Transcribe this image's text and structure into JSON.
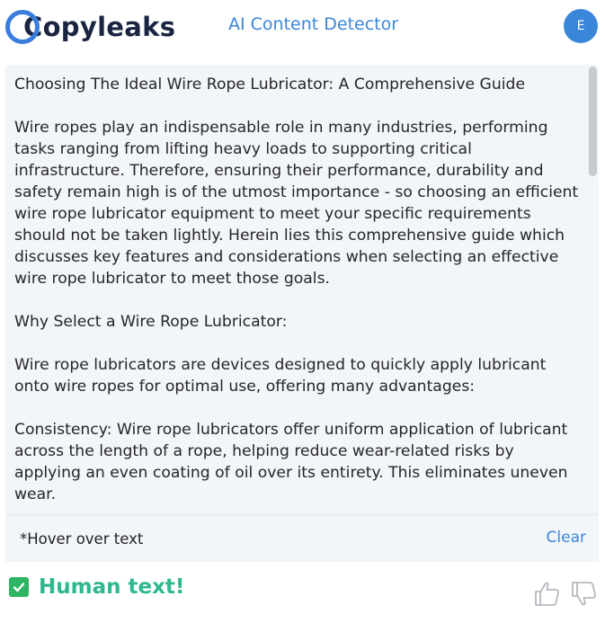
{
  "header": {
    "logo_text": "Copyleaks",
    "title": "AI Content Detector",
    "avatar_initial": "E"
  },
  "content": {
    "text": "Choosing The Ideal Wire Rope Lubricator: A Comprehensive Guide\n\nWire ropes play an indispensable role in many industries, performing tasks ranging from lifting heavy loads to supporting critical infrastructure. Therefore, ensuring their performance, durability and safety remain high is of the utmost importance - so choosing an efficient wire rope lubricator equipment to meet your specific requirements should not be taken lightly. Herein lies this comprehensive guide which discusses key features and considerations when selecting an effective wire rope lubricator to meet those goals.\n\nWhy Select a Wire Rope Lubricator:\n\nWire rope lubricators are devices designed to quickly apply lubricant onto wire ropes for optimal use, offering many advantages:\n\nConsistency: Wire rope lubricators offer uniform application of lubricant across the length of a rope, helping reduce wear-related risks by applying an even coating of oil over its entirety. This eliminates uneven wear.\n\nTime Efficiency: Lubricating wire ropes manually can be time-consuming and"
  },
  "footer": {
    "hover_hint": "*Hover over text",
    "clear_label": "Clear"
  },
  "result": {
    "label": "Human text!",
    "color": "#2fb88f"
  },
  "icons": {
    "check": "checkmark-icon",
    "thumbs_up": "thumbs-up-icon",
    "thumbs_down": "thumbs-down-icon"
  }
}
